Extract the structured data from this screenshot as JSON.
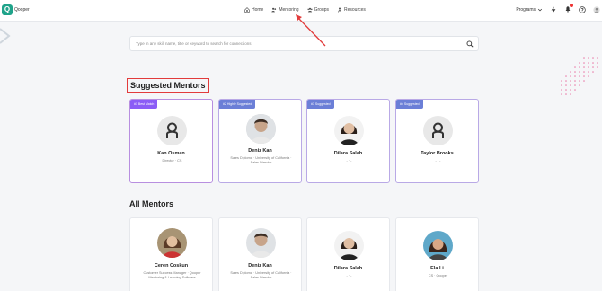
{
  "brand": "Qooper",
  "nav": {
    "home": "Home",
    "mentoring": "Mentoring",
    "groups": "Groups",
    "resources": "Resources",
    "programs": "Programs"
  },
  "search": {
    "placeholder": "Type in any skill name, title or keyword to search for connections"
  },
  "suggested": {
    "title": "Suggested Mentors",
    "cards": [
      {
        "tag": "#1 Best Match",
        "name": "Kan Osman",
        "desc": "Director · CS",
        "avatar": "default"
      },
      {
        "tag": "#2 Highly Suggested",
        "name": "Deniz Kan",
        "desc": "Sales Diploma · University of California · Sales Director",
        "avatar": "photo-man"
      },
      {
        "tag": "#3 Suggested",
        "name": "Dilara Salah",
        "desc": "- · -",
        "avatar": "photo-woman"
      },
      {
        "tag": "#4 Suggested",
        "name": "Taylor Brooks",
        "desc": "- · -",
        "avatar": "default"
      }
    ]
  },
  "all": {
    "title": "All Mentors",
    "cards": [
      {
        "name": "Ceren Coskun",
        "desc": "Customer Success Manager · Qooper Mentoring & Learning Software",
        "avatar": "photo-woman2"
      },
      {
        "name": "Deniz Kan",
        "desc": "Sales Diploma · University of California · Sales Director",
        "avatar": "photo-man"
      },
      {
        "name": "Dilara Salah",
        "desc": "- · -",
        "avatar": "photo-woman"
      },
      {
        "name": "Ela Li",
        "desc": "CS · Qooper",
        "avatar": "photo-woman3"
      }
    ]
  },
  "colors": {
    "accent": "#1fa38a",
    "tag_purple": "#8b5cf6",
    "tag_blue": "#6b7fd7",
    "highlight_red": "#e23b3b"
  }
}
